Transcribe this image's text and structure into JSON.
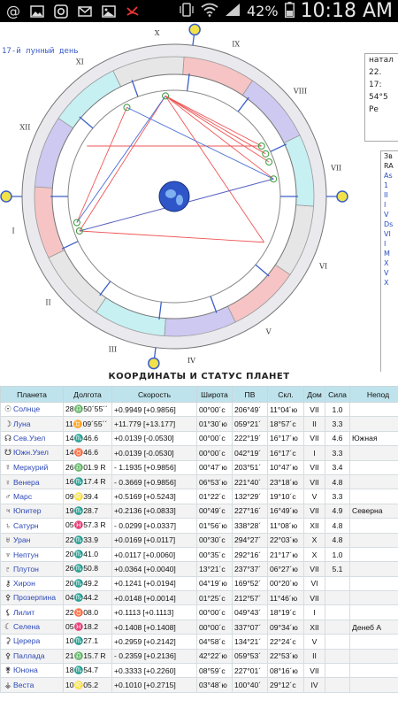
{
  "status_bar": {
    "left_icons": [
      "at-sign-icon",
      "gallery-icon",
      "instagram-icon",
      "email-icon",
      "image-icon",
      "missed-call-icon"
    ],
    "battery": "42%",
    "time": "10:18 AM"
  },
  "chart": {
    "lunar_day": "17-й лунный день",
    "house_numerals": [
      "I",
      "II",
      "III",
      "IV",
      "V",
      "VI",
      "VII",
      "VIII",
      "IX",
      "X",
      "XI",
      "XII"
    ],
    "side_panel": [
      "натал",
      "22.",
      "17:",
      "54°5",
      "Ре"
    ],
    "side_panel2": [
      "Зв",
      "RA",
      "As",
      "1",
      "II",
      "I",
      "V",
      "Ds",
      "VI",
      "I",
      "M",
      "X",
      "V",
      "X"
    ]
  },
  "table": {
    "title": "КООРДИНАТЫ И СТАТУС ПЛАНЕТ",
    "headers": [
      "Планета",
      "Долгота",
      "Скорость",
      "Широта",
      "ПВ",
      "Скл.",
      "Дом",
      "Сила",
      "Непод"
    ],
    "rows": [
      {
        "glyph": "☉",
        "name": "Солнце",
        "long": "28♎50´55´´",
        "speed": "+0.9949 [+0.9856]",
        "lat": "00°00´с",
        "pv": "206°49´",
        "decl": "11°04´ю",
        "house": "VII",
        "power": "1.0",
        "dep": ""
      },
      {
        "glyph": "☽",
        "name": "Луна",
        "long": "11♊09´55´´",
        "speed": "+11.779 [+13.177]",
        "lat": "01°30´ю",
        "pv": "059°21´",
        "decl": "18°57´с",
        "house": "II",
        "power": "3.3",
        "dep": ""
      },
      {
        "glyph": "☊",
        "name": "Сев.Узел",
        "long": "14♏46.6",
        "speed": "+0.0139 [-0.0530]",
        "lat": "00°00´с",
        "pv": "222°19´",
        "decl": "16°17´ю",
        "house": "VII",
        "power": "4.6",
        "dep": "Южная"
      },
      {
        "glyph": "☋",
        "name": "Южн.Узел",
        "long": "14♉46.6",
        "speed": "+0.0139 [-0.0530]",
        "lat": "00°00´с",
        "pv": "042°19´",
        "decl": "16°17´с",
        "house": "I",
        "power": "3.3",
        "dep": ""
      },
      {
        "glyph": "☿",
        "name": "Меркурий",
        "long": "26♎01.9 R",
        "speed": "- 1.1935 [+0.9856]",
        "lat": "00°47´ю",
        "pv": "203°51´",
        "decl": "10°47´ю",
        "house": "VII",
        "power": "3.4",
        "dep": ""
      },
      {
        "glyph": "♀",
        "name": "Венера",
        "long": "16♏17.4 R",
        "speed": "- 0.3669 [+0.9856]",
        "lat": "06°53´ю",
        "pv": "221°40´",
        "decl": "23°18´ю",
        "house": "VII",
        "power": "4.8",
        "dep": ""
      },
      {
        "glyph": "♂",
        "name": "Марс",
        "long": "09♌39.4",
        "speed": "+0.5169 [+0.5243]",
        "lat": "01°22´с",
        "pv": "132°29´",
        "decl": "19°10´с",
        "house": "V",
        "power": "3.3",
        "dep": ""
      },
      {
        "glyph": "♃",
        "name": "Юпитер",
        "long": "19♏28.7",
        "speed": "+0.2136 [+0.0833]",
        "lat": "00°49´с",
        "pv": "227°16´",
        "decl": "16°49´ю",
        "house": "VII",
        "power": "4.9",
        "dep": "Северна"
      },
      {
        "glyph": "♄",
        "name": "Сатурн",
        "long": "05♓57.3 R",
        "speed": "- 0.0299 [+0.0337]",
        "lat": "01°56´ю",
        "pv": "338°28´",
        "decl": "11°08´ю",
        "house": "XII",
        "power": "4.8",
        "dep": ""
      },
      {
        "glyph": "♅",
        "name": "Уран",
        "long": "22♏33.9",
        "speed": "+0.0169 [+0.0117]",
        "lat": "00°30´с",
        "pv": "294°27´",
        "decl": "22°03´ю",
        "house": "X",
        "power": "4.8",
        "dep": ""
      },
      {
        "glyph": "♆",
        "name": "Нептун",
        "long": "20♏41.0",
        "speed": "+0.0117 [+0.0060]",
        "lat": "00°35´с",
        "pv": "292°16´",
        "decl": "21°17´ю",
        "house": "X",
        "power": "1.0",
        "dep": ""
      },
      {
        "glyph": "♇",
        "name": "Плутон",
        "long": "26♏50.8",
        "speed": "+0.0364 [+0.0040]",
        "lat": "13°21´с",
        "pv": "237°37´",
        "decl": "06°27´ю",
        "house": "VII",
        "power": "5.1",
        "dep": ""
      },
      {
        "glyph": "⚷",
        "name": "Хирон",
        "long": "20♏49.2",
        "speed": "+0.1241 [+0.0194]",
        "lat": "04°19´ю",
        "pv": "169°52´",
        "decl": "00°20´ю",
        "house": "VI",
        "power": "",
        "dep": ""
      },
      {
        "glyph": "⚴",
        "name": "Прозерпина",
        "long": "04♏44.2",
        "speed": "+0.0148 [+0.0014]",
        "lat": "01°25´с",
        "pv": "212°57´",
        "decl": "11°46´ю",
        "house": "VII",
        "power": "",
        "dep": ""
      },
      {
        "glyph": "⚸",
        "name": "Лилит",
        "long": "22♉08.0",
        "speed": "+0.1113 [+0.1113]",
        "lat": "00°00´с",
        "pv": "049°43´",
        "decl": "18°19´с",
        "house": "I",
        "power": "",
        "dep": ""
      },
      {
        "glyph": "☾",
        "name": "Селена",
        "long": "05♓18.2",
        "speed": "+0.1408 [+0.1408]",
        "lat": "00°00´с",
        "pv": "337°07´",
        "decl": "09°34´ю",
        "house": "XII",
        "power": "",
        "dep": "Денеб А"
      },
      {
        "glyph": "⚳",
        "name": "Церера",
        "long": "10♏27.1",
        "speed": "+0.2959 [+0.2142]",
        "lat": "04°58´с",
        "pv": "134°21´",
        "decl": "22°24´с",
        "house": "V",
        "power": "",
        "dep": ""
      },
      {
        "glyph": "⚴",
        "name": "Паллада",
        "long": "21♎15.7 R",
        "speed": "- 0.2359 [+0.2136]",
        "lat": "42°22´ю",
        "pv": "059°53´",
        "decl": "22°53´ю",
        "house": "II",
        "power": "",
        "dep": ""
      },
      {
        "glyph": "⚵",
        "name": "Юнона",
        "long": "18♏54.7",
        "speed": "+0.3333 [+0.2260]",
        "lat": "08°59´с",
        "pv": "227°01´",
        "decl": "08°16´ю",
        "house": "VII",
        "power": "",
        "dep": ""
      },
      {
        "glyph": "⚶",
        "name": "Веста",
        "long": "10♌05.2",
        "speed": "+0.1010 [+0.2715]",
        "lat": "03°48´ю",
        "pv": "100°40´",
        "decl": "29°12´с",
        "house": "IV",
        "power": "",
        "dep": ""
      }
    ]
  }
}
